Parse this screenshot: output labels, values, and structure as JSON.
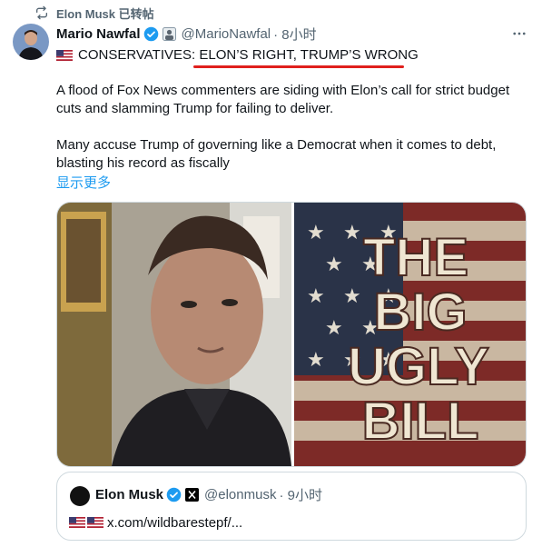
{
  "repost": {
    "icon": "repost-icon",
    "text": "Elon Musk 已转帖"
  },
  "post": {
    "author_name": "Mario Nawfal",
    "handle": "@MarioNawfal",
    "time": "· 8小时",
    "headline_flag": "us-flag",
    "headline_prefix": "CONSERVATIVES:",
    "headline_highlight": "ELON’S RIGHT, TRUMP’S WRONG",
    "paragraph1": "A flood of Fox News commenters are siding with Elon’s call for strict budget cuts and slamming Trump for failing to deliver.",
    "paragraph2": "Many accuse Trump of governing like a Democrat when it comes to debt, blasting his record as fiscally",
    "show_more": "显示更多",
    "media": {
      "poster_lines": [
        "THE",
        "BIG",
        "UGLY",
        "BILL"
      ]
    }
  },
  "quote": {
    "author_name": "Elon Musk",
    "handle": "@elonmusk",
    "time": "· 9小时",
    "link": "x.com/wildbarestepf/..."
  },
  "colors": {
    "accent": "#1d9bf0",
    "underline": "#e0201d",
    "muted": "#536471",
    "text": "#0f1419"
  }
}
